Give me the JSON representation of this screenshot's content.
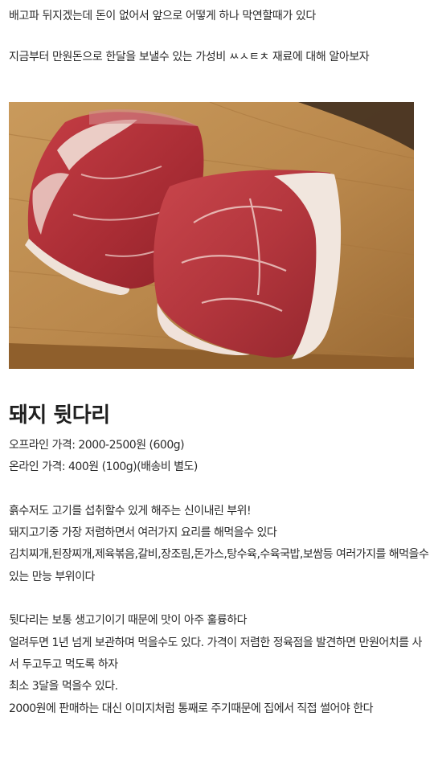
{
  "intro": {
    "line1": "배고파 뒤지겠는데 돈이 없어서 앞으로 어떻게 하나 막연할때가 있다",
    "line2": "지금부터 만원돈으로 한달을 보낼수 있는 가성비 ㅆㅅㅌㅊ 재료에 대해 알아보자"
  },
  "photo": {
    "subject": "raw pork hind leg on a wooden cutting board",
    "colors": {
      "board": "#b8864a",
      "background": "#3b2a1d",
      "meat": "#b8343b",
      "fat": "#f1e4dc"
    }
  },
  "article": {
    "title": "돼지 뒷다리",
    "offline_price": "오프라인 가격: 2000-2500원 (600g)",
    "online_price": "온라인 가격: 400원 (100g)(배송비 별도)",
    "para1": [
      "흙수저도 고기를 섭취할수 있게 해주는 신이내린 부위!",
      "돼지고기중 가장 저렴하면서 여러가지 요리를 해먹을수 있다",
      "김치찌개,된장찌개,제육볶음,갈비,장조림,돈가스,탕수육,수육국밥,보쌈등 여러가지를 해먹을수 있는 만능 부위이다"
    ],
    "para2": [
      "뒷다리는 보통 생고기이기 때문에 맛이 아주 훌륭하다",
      "얼려두면 1년 넘게 보관하며 먹을수도 있다. 가격이 저렴한 정육점을 발견하면 만원어치를 사서 두고두고 먹도록 하자",
      "최소 3달을 먹을수 있다.",
      "2000원에 판매하는 대신 이미지처럼 통째로 주기때문에 집에서 직접 썰어야 한다"
    ]
  }
}
